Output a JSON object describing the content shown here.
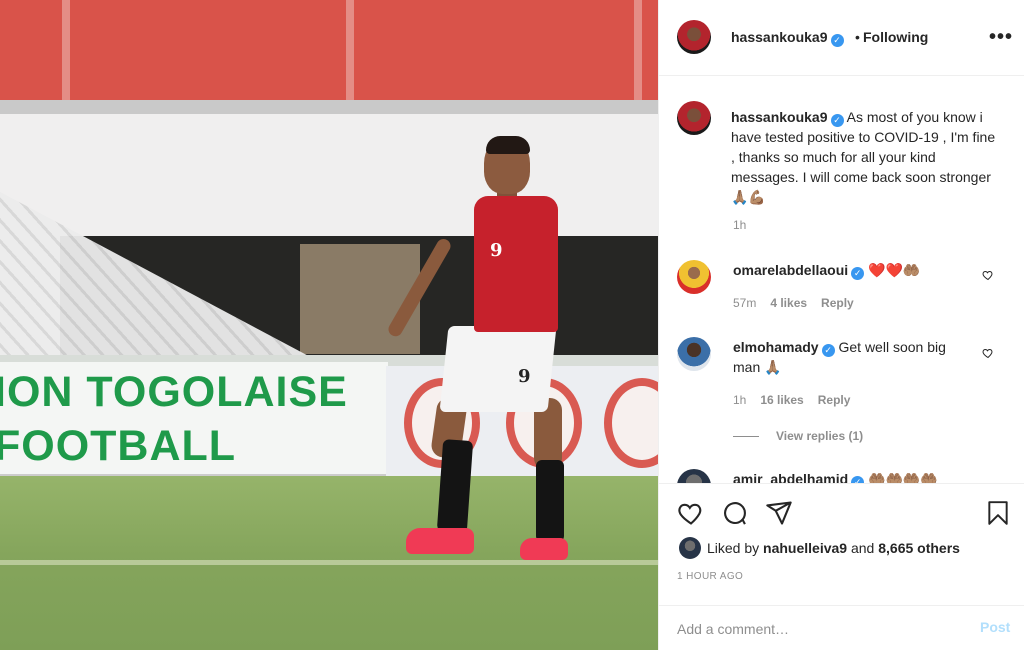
{
  "post": {
    "photo_banner_line1": "ION TOGOLAISE",
    "photo_banner_line2": "FOOTBALL",
    "jersey_number": "9"
  },
  "header": {
    "username": "hassankouka9",
    "dot": "•",
    "follow_status": "Following",
    "more_label": "•••"
  },
  "caption": {
    "username": "hassankouka9",
    "text": "As most of you know i have tested positive to COVID-19 , I'm fine , thanks so much for all your kind messages. I will come back soon stronger 🙏🏽💪🏽",
    "time": "1h"
  },
  "comments": [
    {
      "username": "omarelabdellaoui",
      "text": "❤️❤️🤲🏽",
      "time": "57m",
      "likes": "4 likes",
      "reply": "Reply"
    },
    {
      "username": "elmohamady",
      "text": "Get well soon big man 🙏🏽",
      "time": "1h",
      "likes": "16 likes",
      "reply": "Reply",
      "view_replies": "View replies (1)"
    },
    {
      "username": "amir_abdelhamid",
      "text": "🤲🏽🤲🏽🤲🏽🤲🏽"
    }
  ],
  "actions": {
    "liked_by_prefix": "Liked by",
    "liked_by_user": "nahuelleiva9",
    "liked_by_suffix": "and",
    "others": "8,665 others",
    "timestamp": "1 HOUR AGO"
  },
  "add_comment": {
    "placeholder": "Add a comment…",
    "post_label": "Post"
  },
  "colors": {
    "link_blue": "#3897f0",
    "post_disabled": "#b2dffc",
    "heart_red": "#ed4956"
  }
}
